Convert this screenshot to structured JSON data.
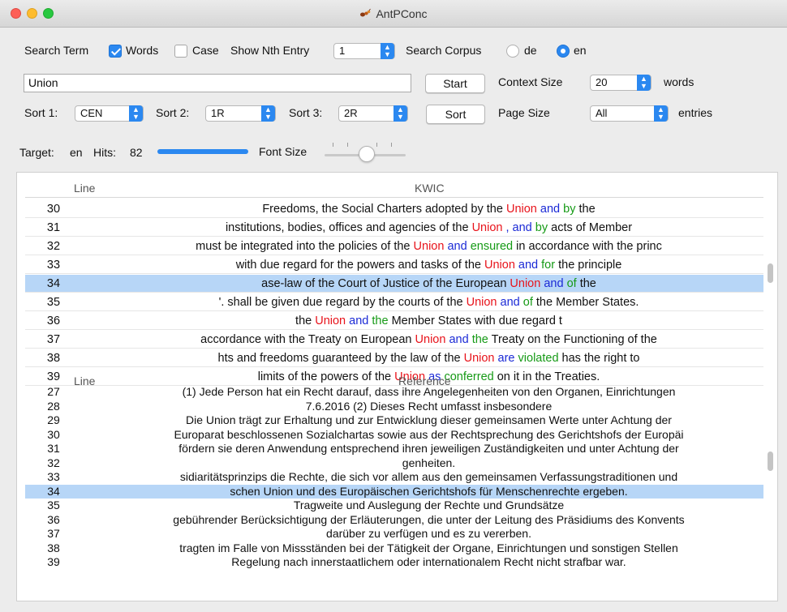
{
  "window": {
    "title": "AntPConc"
  },
  "search": {
    "search_term_label": "Search Term",
    "words_label": "Words",
    "case_label": "Case",
    "show_nth_label": "Show Nth Entry",
    "show_nth_value": "1",
    "search_corpus_label": "Search Corpus",
    "corpus_options": [
      "de",
      "en"
    ],
    "corpus_selected": "en",
    "term_value": "Union",
    "start_label": "Start",
    "context_size_label": "Context Size",
    "context_size_value": "20",
    "context_unit": "words",
    "sort1_label": "Sort 1:",
    "sort1_value": "CEN",
    "sort2_label": "Sort 2:",
    "sort2_value": "1R",
    "sort3_label": "Sort 3:",
    "sort3_value": "2R",
    "sort_label": "Sort",
    "page_size_label": "Page Size",
    "page_size_value": "All",
    "page_size_unit": "entries"
  },
  "status": {
    "target_label": "Target:",
    "target_value": "en",
    "hits_label": "Hits:",
    "hits_value": "82",
    "font_size_label": "Font Size",
    "font_size_level": 0.5
  },
  "kwic": {
    "line_header": "Line",
    "kwic_header": "KWIC",
    "selected_line": "34",
    "rows": [
      {
        "line": "30",
        "left": "Freedoms, the Social Charters adopted by the ",
        "kw": "Union",
        "c1": "and",
        "c2": "by",
        "right": "the"
      },
      {
        "line": "31",
        "left": "institutions, bodies, offices and agencies of the ",
        "kw": "Union",
        "c1": ", and",
        "c2": "by",
        "right": "acts of Member"
      },
      {
        "line": "32",
        "left": "must be integrated into the policies of the ",
        "kw": "Union",
        "c1": "and",
        "c2": "ensured",
        "right": "in accordance with the princ"
      },
      {
        "line": "33",
        "left": "with due regard for the powers and tasks of the ",
        "kw": "Union",
        "c1": "and",
        "c2": "for",
        "right": "the principle"
      },
      {
        "line": "34",
        "left": "ase-law of the Court of Justice of the European ",
        "kw": "Union",
        "c1": "and",
        "c2": "of",
        "right": "the"
      },
      {
        "line": "35",
        "left": "'. shall be given due regard by the courts of the ",
        "kw": "Union",
        "c1": "and",
        "c2": "of",
        "right": "the Member States."
      },
      {
        "line": "36",
        "left": "the ",
        "kw": "Union",
        "c1": "and",
        "c2": "the",
        "right": "Member States with due regard t"
      },
      {
        "line": "37",
        "left": "accordance with the Treaty on European ",
        "kw": "Union",
        "c1": "and",
        "c2": "the",
        "right": "Treaty on the Functioning of the"
      },
      {
        "line": "38",
        "left": "hts and freedoms guaranteed by the law of the ",
        "kw": "Union",
        "c1": "are",
        "c2": "violated",
        "right": "has the right to"
      },
      {
        "line": "39",
        "left": "limits of the powers of the ",
        "kw": "Union",
        "c1": "as",
        "c2": "conferred",
        "right": "on it in the Treaties."
      }
    ]
  },
  "reference": {
    "line_header": "Line",
    "ref_header": "Reference",
    "selected_line": "34",
    "rows": [
      {
        "line": "27",
        "text": "(1) Jede Person hat ein Recht darauf, dass ihre Angelegenheiten von den Organen, Einrichtungen"
      },
      {
        "line": "28",
        "text": "7.6.2016 (2) Dieses Recht umfasst insbesondere"
      },
      {
        "line": "29",
        "text": "Die Union trägt zur Erhaltung und zur Entwicklung dieser gemeinsamen Werte unter Achtung der"
      },
      {
        "line": "30",
        "text": "Europarat beschlossenen Sozialchartas sowie aus der Rechtsprechung des Gerichtshofs der Europäi"
      },
      {
        "line": "31",
        "text": "fördern sie deren Anwendung entsprechend ihren jeweiligen Zuständigkeiten und unter Achtung der"
      },
      {
        "line": "32",
        "text": "genheiten."
      },
      {
        "line": "33",
        "text": "sidiaritätsprinzips die Rechte, die sich vor allem aus den gemeinsamen Verfassungstraditionen und"
      },
      {
        "line": "34",
        "text": "schen Union und des Europäischen Gerichtshofs für Menschenrechte ergeben."
      },
      {
        "line": "35",
        "text": "Tragweite und Auslegung der Rechte und Grundsätze"
      },
      {
        "line": "36",
        "text": "gebührender Berücksichtigung der Erläuterungen, die unter der Leitung des Präsidiums des Konvents"
      },
      {
        "line": "37",
        "text": "darüber zu verfügen und es zu vererben."
      },
      {
        "line": "38",
        "text": "tragten im Falle von Missständen bei der Tätigkeit der Organe, Einrichtungen und sonstigen Stellen"
      },
      {
        "line": "39",
        "text": "Regelung nach innerstaatlichem oder internationalem Recht nicht strafbar war."
      }
    ]
  }
}
